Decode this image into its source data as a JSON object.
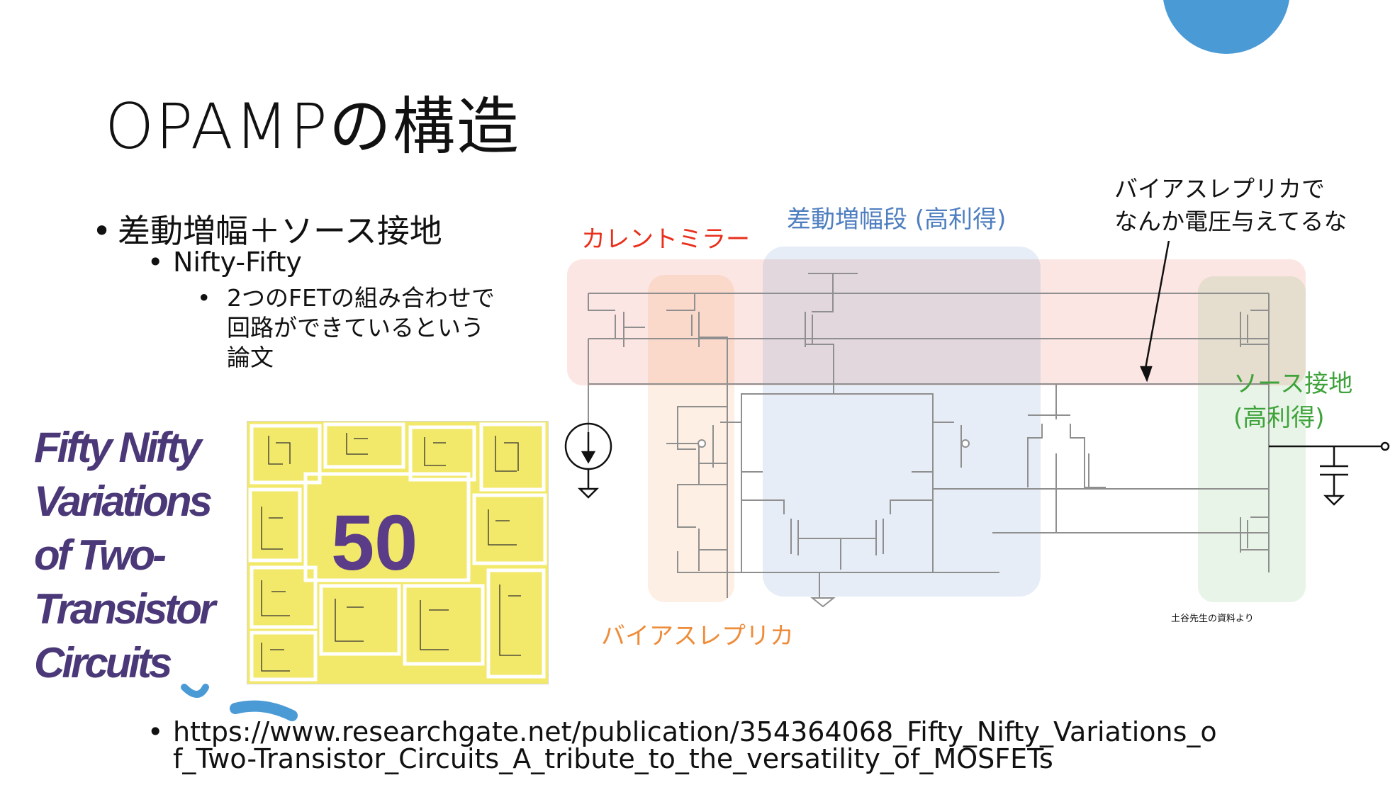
{
  "slide": {
    "title": "OPAMPの構造",
    "bullets": {
      "level1": "差動増幅＋ソース接地",
      "level2": "Nifty-Fifty",
      "level3_lines": [
        "2つのFETの組み合わせで",
        "回路ができているという",
        "論文"
      ]
    },
    "bullet_symbol": "•",
    "url_lines": [
      "https://www.researchgate.net/publication/354364068_Fifty_Nifty_Variations_o",
      "f_Two-Transistor_Circuits_A_tribute_to_the_versatility_of_MOSFETs"
    ]
  },
  "book_title": {
    "lines": [
      "Fifty Nifty",
      "Variations",
      "of Two-",
      "Transistor",
      "Circuits"
    ],
    "color": "#4a3878"
  },
  "book_cover": {
    "number": "50",
    "background": "#f2e86a",
    "number_color": "#5b3c88"
  },
  "circuit": {
    "labels": {
      "current_mirror": "カレントミラー",
      "diff_amp": "差動増幅段 (高利得)",
      "bias_replica": "バイアスレプリカ",
      "source_ground_line1": "ソース接地",
      "source_ground_line2": "(高利得)"
    },
    "annotation_lines": [
      "バイアスレプリカで",
      "なんか電圧与えてるな"
    ],
    "credit": "土谷先生の資料より",
    "colors": {
      "current_mirror": "#e8301c",
      "diff_amp": "#4f7fc0",
      "bias_replica": "#ee8c3a",
      "source_ground": "#3ea33a",
      "wire": "#9a9a9a"
    }
  },
  "decor": {
    "circle_color": "#4a9ad6"
  }
}
